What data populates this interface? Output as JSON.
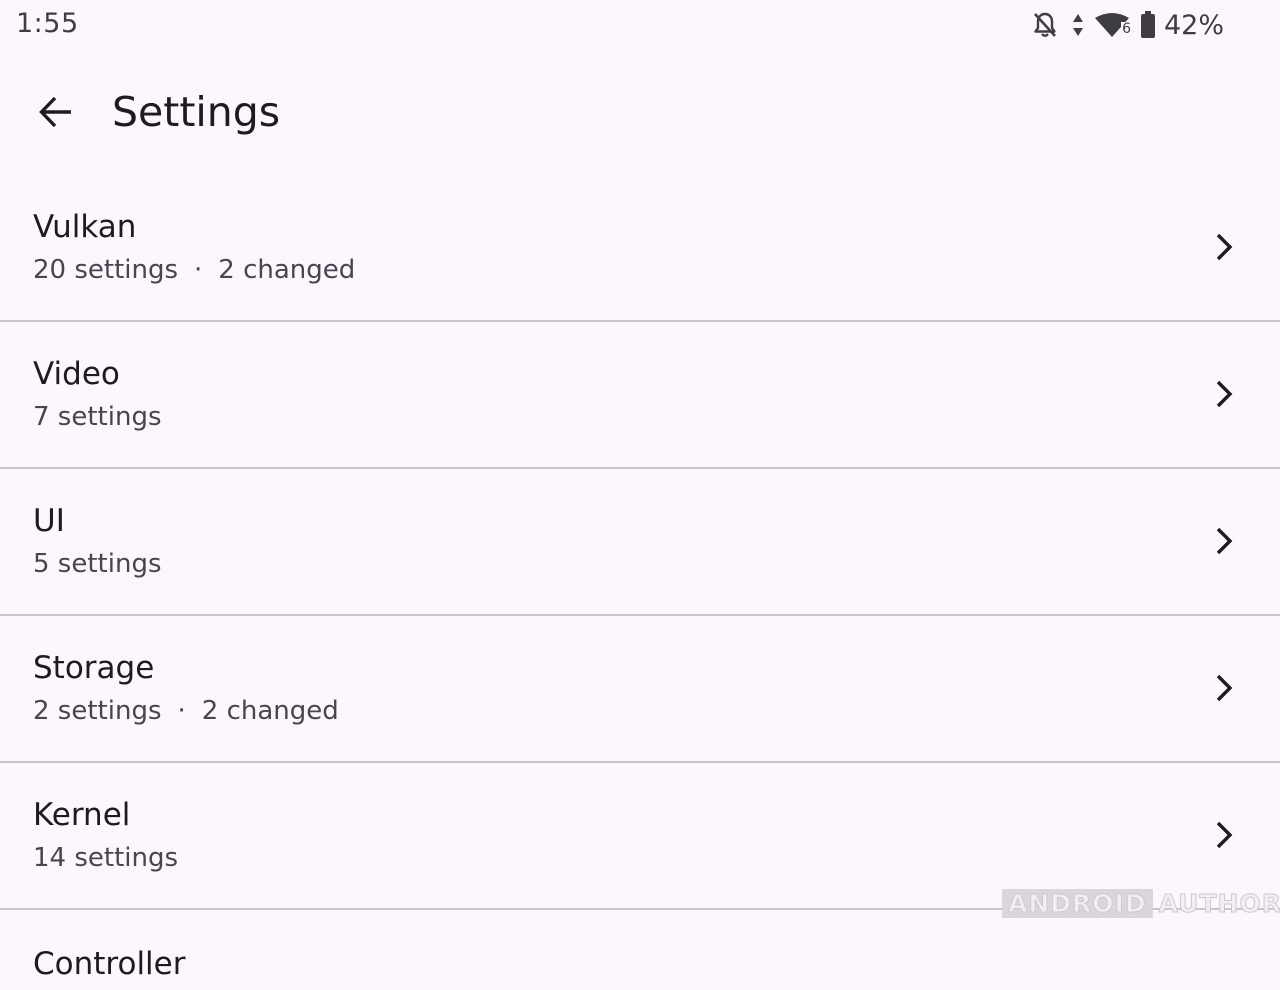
{
  "status_bar": {
    "time": "1:55",
    "icons": [
      "bell-off-icon",
      "data-arrows-icon",
      "wifi-icon",
      "battery-icon"
    ],
    "wifi_badge": "6",
    "battery_level": "42%"
  },
  "app_bar": {
    "title": "Settings",
    "back_icon": "arrow-back-icon"
  },
  "settings": {
    "separator": "·",
    "items": [
      {
        "title": "Vulkan",
        "count": "20 settings",
        "changed": "2 changed"
      },
      {
        "title": "Video",
        "count": "7 settings",
        "changed": ""
      },
      {
        "title": "UI",
        "count": "5 settings",
        "changed": ""
      },
      {
        "title": "Storage",
        "count": "2 settings",
        "changed": "2 changed"
      },
      {
        "title": "Kernel",
        "count": "14 settings",
        "changed": ""
      },
      {
        "title": "Controller"
      }
    ]
  },
  "watermark": {
    "part1": "ANDROID",
    "part2": "AUTHORITY"
  },
  "colors": {
    "background": "#fcf7fc",
    "divider": "#cac4cf",
    "primary_text": "#1d1b20",
    "secondary_text": "#49454f"
  }
}
